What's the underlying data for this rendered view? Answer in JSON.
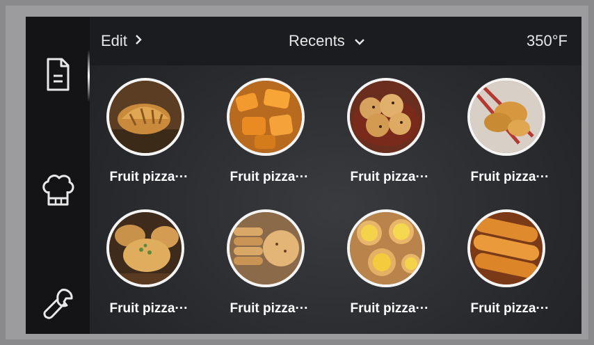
{
  "header": {
    "edit_label": "Edit",
    "recents_label": "Recents",
    "temperature": "350°F"
  },
  "sidebar": {
    "items": [
      {
        "icon": "document-icon",
        "active": true
      },
      {
        "icon": "chef-hat-icon",
        "active": false
      },
      {
        "icon": "wrench-icon",
        "active": false
      }
    ]
  },
  "recipes": [
    {
      "label": "Fruit pizza···",
      "image": "croissant"
    },
    {
      "label": "Fruit pizza···",
      "image": "sweet-potato"
    },
    {
      "label": "Fruit pizza···",
      "image": "cookies"
    },
    {
      "label": "Fruit pizza···",
      "image": "bread-basket"
    },
    {
      "label": "Fruit pizza···",
      "image": "buns"
    },
    {
      "label": "Fruit pizza···",
      "image": "stacked-cookies"
    },
    {
      "label": "Fruit pizza···",
      "image": "egg-tarts"
    },
    {
      "label": "Fruit pizza···",
      "image": "hot-dog-buns"
    }
  ],
  "colors": {
    "background": "#1e1f22",
    "sidebar": "#141416",
    "text": "#ffffff",
    "thumb_border": "#f4f4f4"
  }
}
